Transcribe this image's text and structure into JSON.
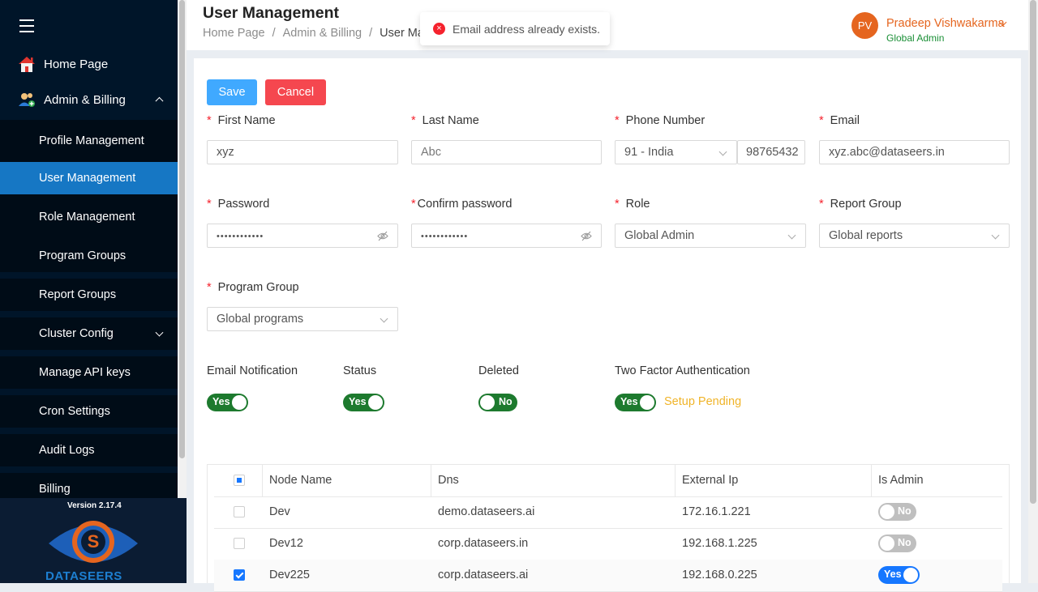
{
  "sidebar": {
    "home": "Home Page",
    "admin_billing": "Admin & Billing",
    "items": [
      {
        "label": "Profile Management"
      },
      {
        "label": "User Management"
      },
      {
        "label": "Role Management"
      },
      {
        "label": "Program Groups"
      },
      {
        "label": "Report Groups"
      },
      {
        "label": "Cluster Config"
      },
      {
        "label": "Manage API keys"
      },
      {
        "label": "Cron Settings"
      },
      {
        "label": "Audit Logs"
      },
      {
        "label": "Billing"
      }
    ],
    "version": "Version 2.17.4",
    "brand": "DATASEERS"
  },
  "header": {
    "title": "User Management",
    "breadcrumb": [
      "Home Page",
      "Admin & Billing",
      "User Man"
    ],
    "toast": "Email address already exists.",
    "user": {
      "initials": "PV",
      "name": "Pradeep Vishwakarma",
      "role": "Global Admin"
    }
  },
  "form": {
    "save": "Save",
    "cancel": "Cancel",
    "first_name": {
      "label": "First Name",
      "value": "xyz"
    },
    "last_name": {
      "label": "Last Name",
      "placeholder": "Abc"
    },
    "phone": {
      "label": "Phone Number",
      "country": "91 - India",
      "value": "98765432"
    },
    "email": {
      "label": "Email",
      "value": "xyz.abc@dataseers.in"
    },
    "password": {
      "label": "Password",
      "value": "••••••••••••"
    },
    "confirm_password": {
      "label": "Confirm password",
      "value": "••••••••••••"
    },
    "role": {
      "label": "Role",
      "value": "Global Admin"
    },
    "report_group": {
      "label": "Report Group",
      "value": "Global reports"
    },
    "program_group": {
      "label": "Program Group",
      "value": "Global programs"
    },
    "email_notification": {
      "label": "Email Notification",
      "state": "Yes"
    },
    "status": {
      "label": "Status",
      "state": "Yes"
    },
    "deleted": {
      "label": "Deleted",
      "state": "No"
    },
    "two_factor": {
      "label": "Two Factor Authentication",
      "state": "Yes",
      "note": "Setup Pending"
    }
  },
  "table": {
    "headers": [
      "Node Name",
      "Dns",
      "External Ip",
      "Is Admin"
    ],
    "rows": [
      {
        "node": "Dev",
        "dns": "demo.dataseers.ai",
        "ip": "172.16.1.221",
        "admin": "No"
      },
      {
        "node": "Dev12",
        "dns": "corp.dataseers.in",
        "ip": "192.168.1.225",
        "admin": "No"
      },
      {
        "node": "Dev225",
        "dns": "corp.dataseers.ai",
        "ip": "192.168.0.225",
        "admin": "Yes"
      }
    ]
  },
  "colors": {
    "sidebar": "#001529",
    "active": "#1677c4",
    "accent": "#e5651f",
    "toggle_on": "#1d7a2e",
    "pending": "#f0b429"
  }
}
